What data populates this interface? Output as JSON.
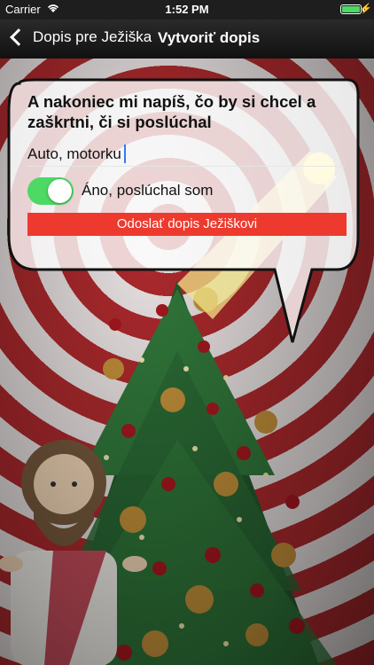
{
  "status_bar": {
    "carrier": "Carrier",
    "time": "1:52 PM",
    "battery_level": 1.0
  },
  "nav": {
    "back_label": "Dopis pre Ježiška",
    "title": "Vytvoriť dopis"
  },
  "form": {
    "question": "A nakoniec mi napíš, čo by si chcel a zaškrtni, či si poslúchal",
    "answer_value": "Auto, motorku",
    "toggle_on": true,
    "toggle_label": "Áno, poslúchal som",
    "send_button": "Odoslať dopis Ježiškovi"
  },
  "colors": {
    "accent_toggle": "#4cd964",
    "send_button": "#ee3a2e",
    "nav_bg": "#1e1e1e"
  },
  "icons": [
    "wifi-icon",
    "battery-icon",
    "charging-bolt-icon",
    "back-chevron-icon"
  ]
}
